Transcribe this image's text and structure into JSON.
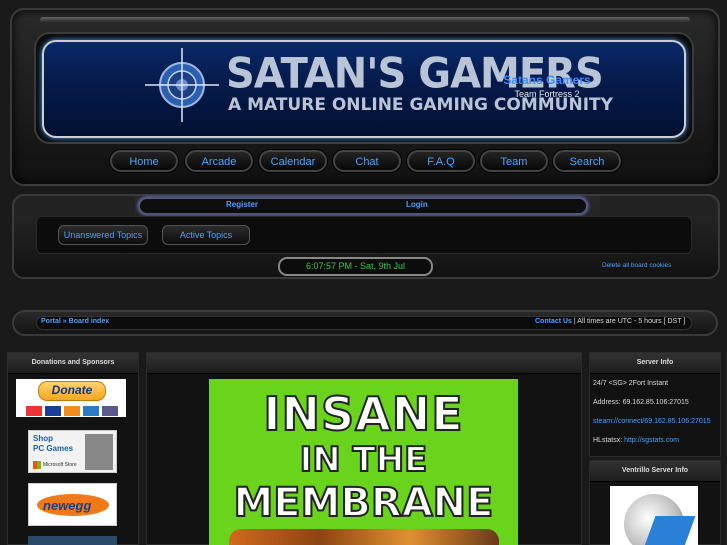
{
  "header": {
    "logo_title": "SATAN'S GAMERS",
    "logo_subtitle": "A MATURE ONLINE GAMING COMMUNITY",
    "site_name": "Satans Gamers",
    "site_game": "Team Fortress 2"
  },
  "nav": {
    "items": [
      {
        "label": "Home"
      },
      {
        "label": "Arcade"
      },
      {
        "label": "Calendar"
      },
      {
        "label": "Chat"
      },
      {
        "label": "F.A.Q"
      },
      {
        "label": "Team"
      },
      {
        "label": "Search"
      }
    ]
  },
  "auth": {
    "register": "Register",
    "login": "Login"
  },
  "quicklinks": {
    "unanswered": "Unanswered Topics",
    "active": "Active Topics"
  },
  "clock": "6:07:57 PM - Sat, 9th Jul",
  "delete_cookies": "Delete all board cookies",
  "breadcrumb": {
    "portal": "Portal",
    "separator": "»",
    "board_index": "Board index",
    "contact": "Contact Us",
    "timezone": " | All times are UTC - 5 hours [ DST ]"
  },
  "left": {
    "heading": "Donations and Sponsors",
    "donate_label": "Donate",
    "pcgames_line1": "Shop",
    "pcgames_line2": "PC Games",
    "pcgames_store": "Microsoft Store",
    "newegg": "newegg"
  },
  "poster": {
    "line1": "INSANE",
    "line2": "IN THE",
    "line3": "MEMBRANE"
  },
  "right": {
    "heading": "Server Info",
    "server_name": "24/7 <SG> 2Fort Instant",
    "address_label": "Address: ",
    "address_value": "69.162.85.106:27015",
    "steam_link": "steam://connect/69.162.85.106:27015",
    "hlstats_label": "HLstatsx: ",
    "hlstats_link": "http://sgstats.com",
    "vent_heading": "Ventrillo Server Info"
  },
  "colors": {
    "accent": "#4d9fff",
    "clock": "#38c74a",
    "poster_bg": "#6ad41c"
  }
}
